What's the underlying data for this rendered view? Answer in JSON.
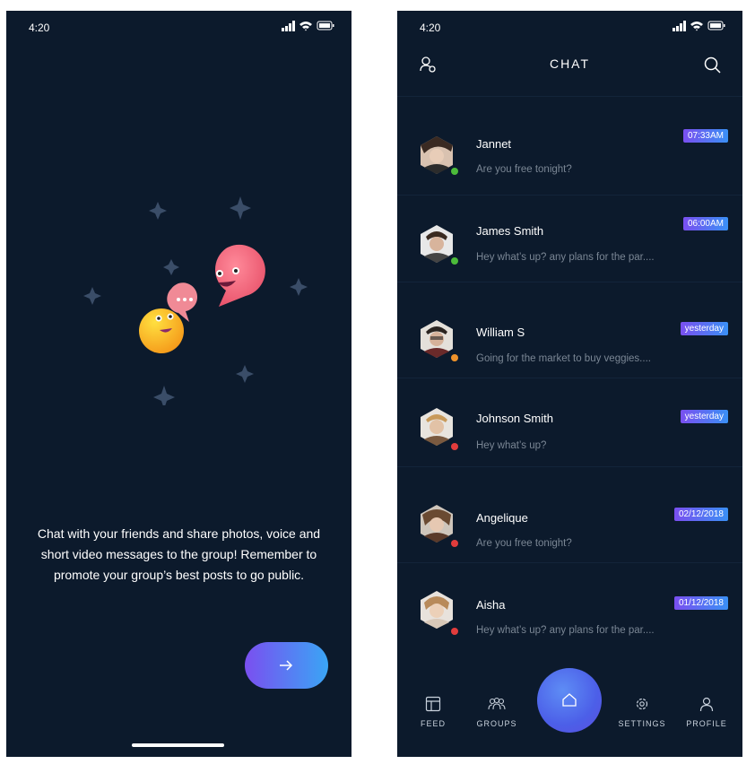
{
  "colors": {
    "background": "#0c1a2c",
    "gradient_start": "#7a4ff0",
    "gradient_end": "#3aa5f5",
    "online": "#4cbb3a",
    "away": "#f0932b",
    "offline": "#e23c3c"
  },
  "onboarding": {
    "status_time": "4:20",
    "message": "Chat with your friends and share photos, voice and short video messages to the group! Remember to promote your group’s best posts to go public.",
    "next_icon": "arrow-right-icon"
  },
  "chat": {
    "status_time": "4:20",
    "title": "CHAT",
    "left_icon": "user-settings-icon",
    "right_icon": "search-icon",
    "conversations": [
      {
        "name": "Jannet",
        "preview": "Are you free tonight?",
        "time": "07:33AM",
        "status": "online"
      },
      {
        "name": "James Smith",
        "preview": "Hey what’s up? any plans for the par....",
        "time": "06:00AM",
        "status": "online"
      },
      {
        "name": "William S",
        "preview": "Going for the market to buy veggies....",
        "time": "yesterday",
        "status": "away"
      },
      {
        "name": "Johnson Smith",
        "preview": "Hey what’s up?",
        "time": "yesterday",
        "status": "offline"
      },
      {
        "name": "Angelique",
        "preview": "Are you free tonight?",
        "time": "02/12/2018",
        "status": "offline"
      },
      {
        "name": "Aisha",
        "preview": "Hey what’s up? any plans for the par....",
        "time": "01/12/2018",
        "status": "offline"
      }
    ],
    "nav": {
      "feed": "FEED",
      "groups": "GROUPS",
      "settings": "SETTINGS",
      "profile": "PROFILE",
      "home_icon": "home-icon"
    }
  }
}
